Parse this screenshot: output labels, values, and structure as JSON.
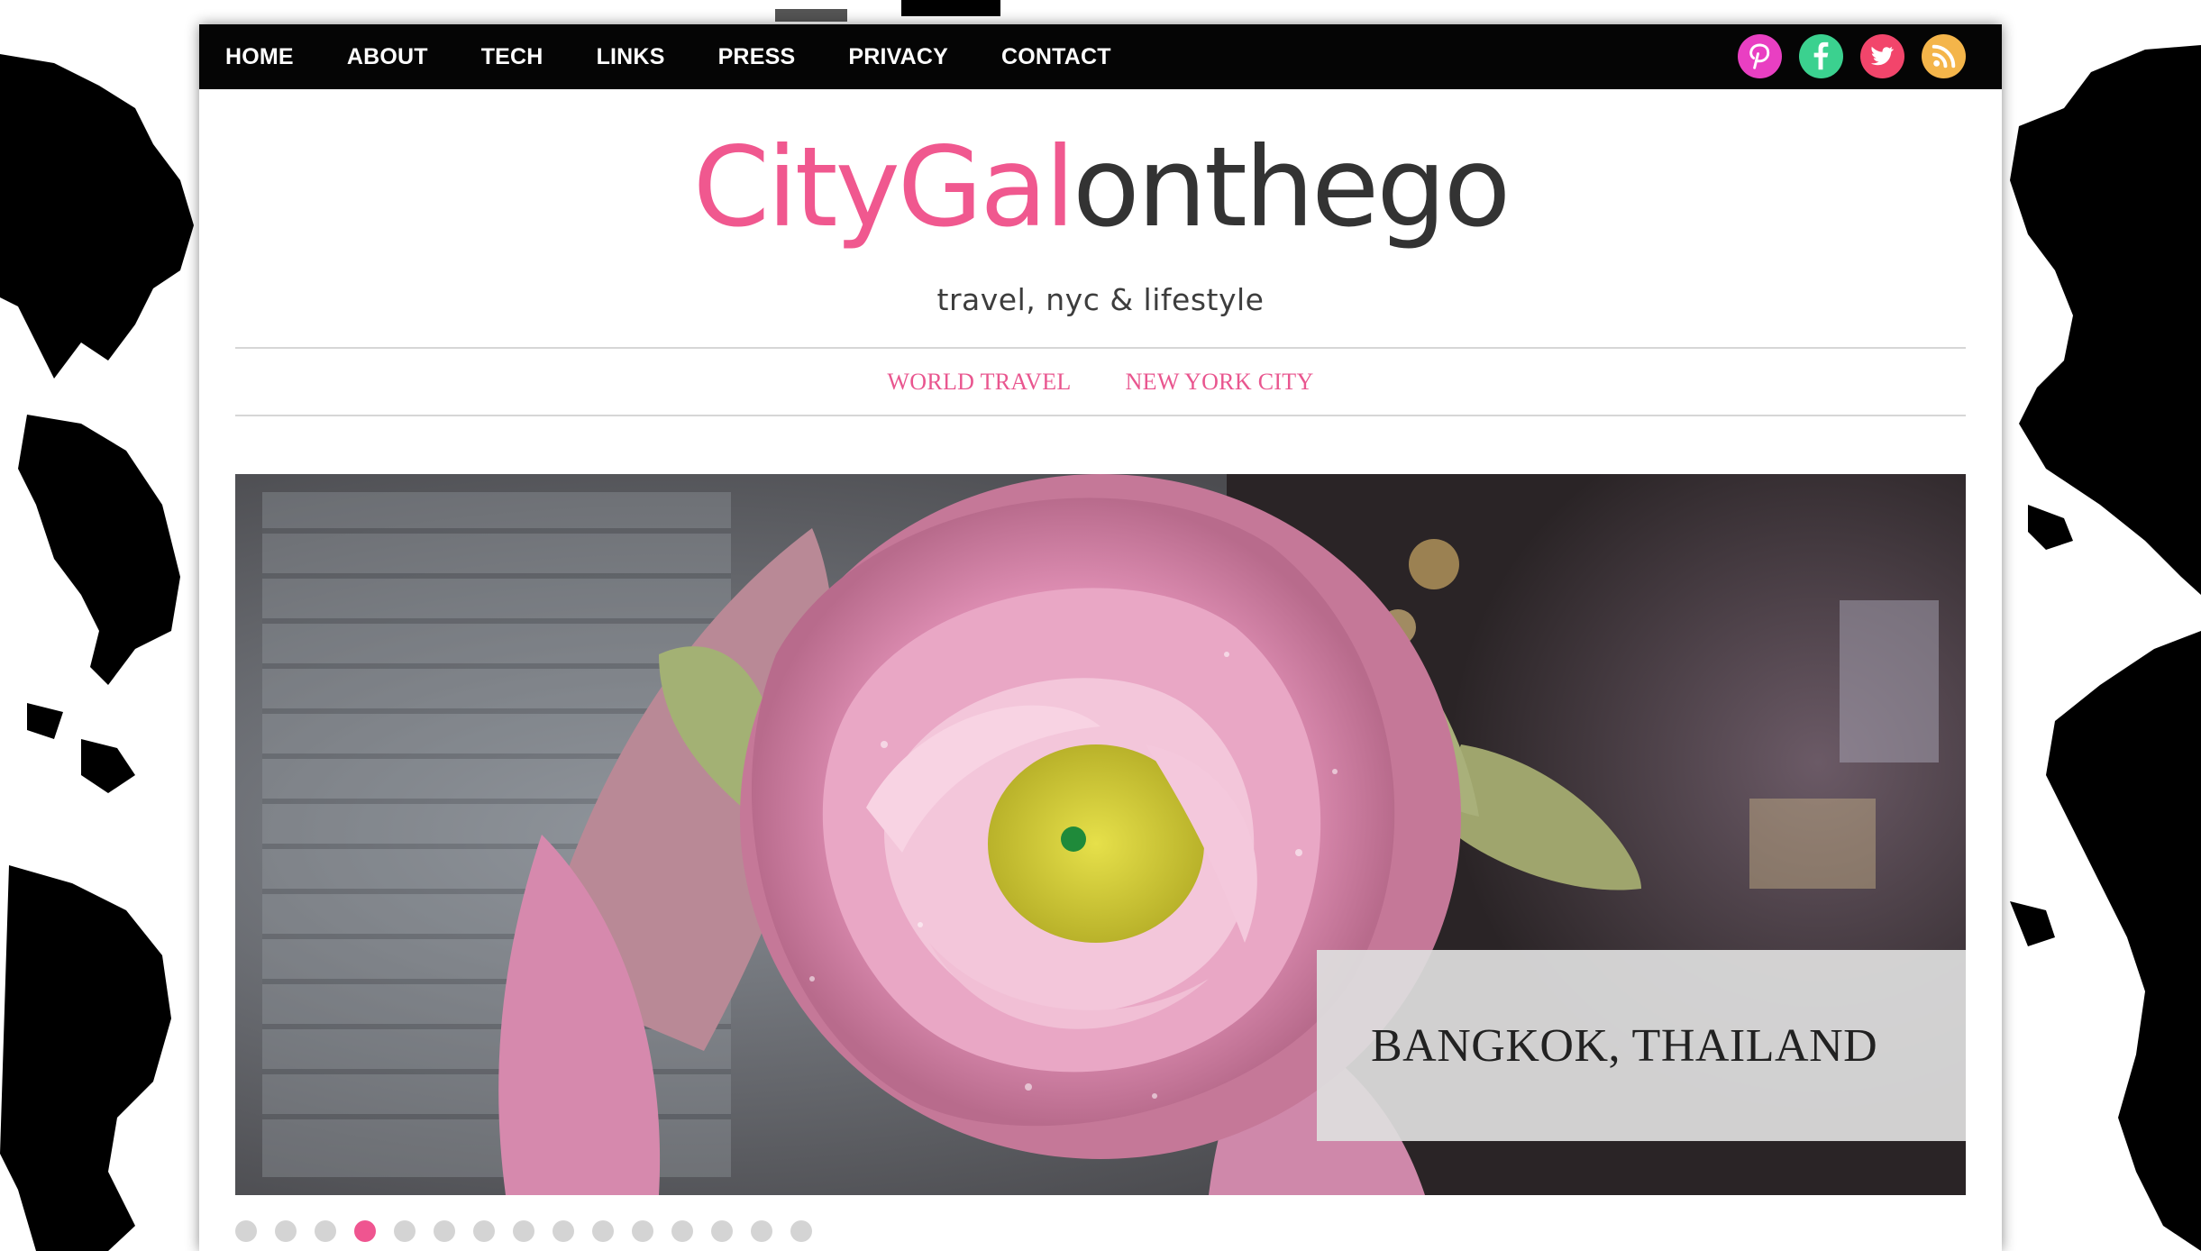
{
  "top_nav": {
    "items": [
      "HOME",
      "ABOUT",
      "TECH",
      "LINKS",
      "PRESS",
      "PRIVACY",
      "CONTACT"
    ]
  },
  "social": {
    "icons": [
      {
        "name": "pinterest-icon",
        "color": "#e93fc2"
      },
      {
        "name": "facebook-icon",
        "color": "#3bd18f"
      },
      {
        "name": "twitter-icon",
        "color": "#f2456b"
      },
      {
        "name": "rss-icon",
        "color": "#f4b54a"
      }
    ]
  },
  "logo": {
    "part1": "CityGal",
    "part2": "onthego",
    "tagline": "travel, nyc & lifestyle",
    "pink": "#f0588f",
    "dark": "#333333"
  },
  "category_nav": {
    "items": [
      "WORLD TRAVEL",
      "NEW YORK CITY"
    ]
  },
  "slider": {
    "caption": "BANGKOK, THAILAND",
    "slide_count": 15,
    "active_slide": 4
  }
}
